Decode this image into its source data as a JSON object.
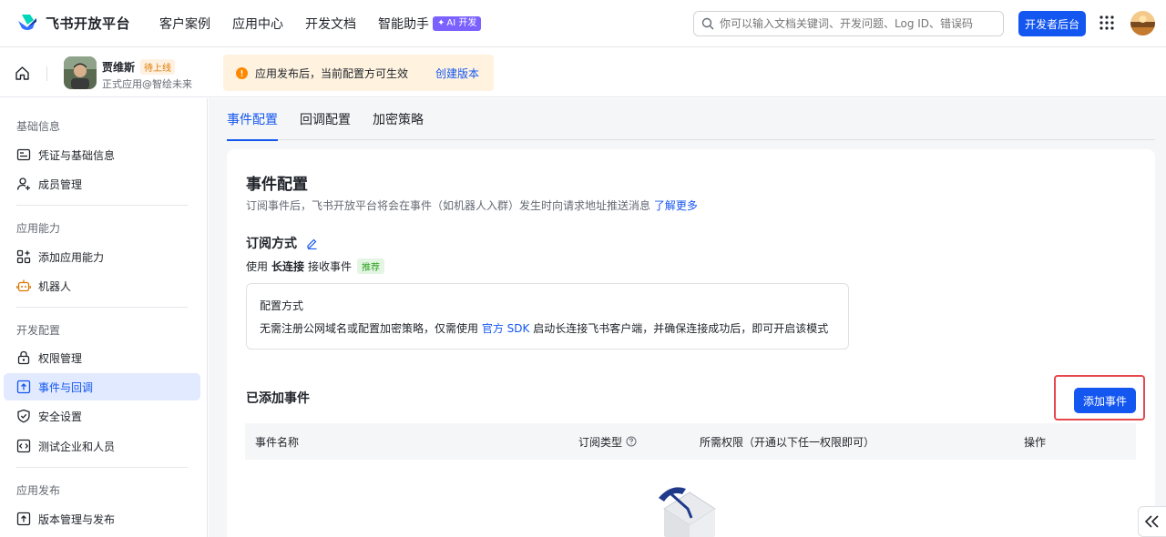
{
  "topnav": {
    "logo_text": "飞书开放平台",
    "links": [
      "客户案例",
      "应用中心",
      "开发文档",
      "智能助手"
    ],
    "ai_badge": "AI 开发",
    "search_placeholder": "你可以输入文档关键词、开发问题、Log ID、错误码",
    "dev_button": "开发者后台"
  },
  "appbar": {
    "app_name": "贾维斯",
    "status_tag": "待上线",
    "app_sub": "正式应用@智绘未来",
    "notice_text": "应用发布后，当前配置方可生效",
    "notice_link": "创建版本"
  },
  "sidebar": {
    "groups": [
      {
        "label": "基础信息",
        "items": [
          {
            "label": "凭证与基础信息",
            "icon": "id-card-icon"
          },
          {
            "label": "成员管理",
            "icon": "user-add-icon"
          }
        ]
      },
      {
        "label": "应用能力",
        "items": [
          {
            "label": "添加应用能力",
            "icon": "apps-add-icon"
          },
          {
            "label": "机器人",
            "icon": "robot-icon"
          }
        ]
      },
      {
        "label": "开发配置",
        "items": [
          {
            "label": "权限管理",
            "icon": "lock-icon"
          },
          {
            "label": "事件与回调",
            "icon": "event-icon",
            "active": true
          },
          {
            "label": "安全设置",
            "icon": "shield-icon"
          },
          {
            "label": "测试企业和人员",
            "icon": "code-icon"
          }
        ]
      },
      {
        "label": "应用发布",
        "items": [
          {
            "label": "版本管理与发布",
            "icon": "upload-icon"
          }
        ]
      }
    ]
  },
  "tabs": [
    "事件配置",
    "回调配置",
    "加密策略"
  ],
  "card": {
    "title": "事件配置",
    "desc": "订阅事件后，飞书开放平台将会在事件（如机器人入群）发生时向请求地址推送消息",
    "desc_link": "了解更多",
    "sub_title": "订阅方式",
    "sub_line_prefix": "使用",
    "sub_line_bold": "长连接",
    "sub_line_suffix": "接收事件",
    "rec_tag": "推荐",
    "mode_title": "配置方式",
    "mode_desc_prefix": "无需注册公网域名或配置加密策略，仅需使用",
    "mode_desc_link": "官方 SDK",
    "mode_desc_suffix": "启动长连接飞书客户端，并确保连接成功后，即可开启该模式",
    "added_title": "已添加事件",
    "add_button": "添加事件",
    "columns": [
      "事件名称",
      "订阅类型",
      "所需权限（开通以下任一权限即可）",
      "操作"
    ]
  },
  "colors": {
    "accent": "#1456f0",
    "active_bg": "#e1eaff",
    "highlight": "#e5484d"
  }
}
